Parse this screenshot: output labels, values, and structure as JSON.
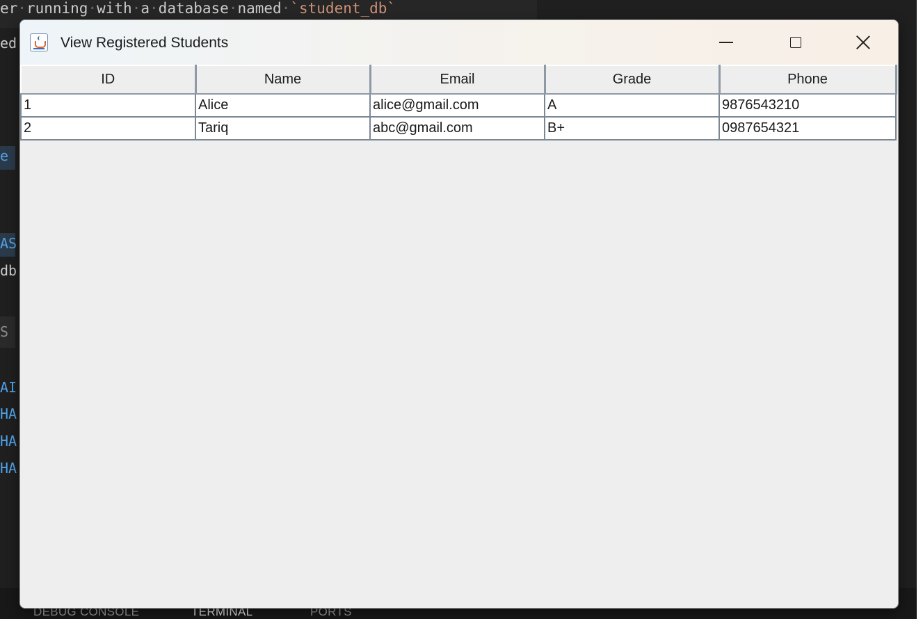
{
  "background_editor": {
    "top_line_prefix": "er",
    "top_line_words": [
      "running",
      "with",
      "a",
      "database",
      "named"
    ],
    "top_line_string": "`student_db`",
    "fragments": [
      "ed",
      "e",
      "AS",
      "db",
      "S",
      "AI",
      "HA",
      "HA",
      "HA"
    ],
    "panel_tabs": [
      "DEBUG CONSOLE",
      "TERMINAL",
      "PORTS"
    ],
    "active_panel_tab": "TERMINAL"
  },
  "window": {
    "title": "View Registered Students",
    "app_icon": "java-cup-icon",
    "controls": {
      "minimize_icon": "minimize-icon",
      "maximize_icon": "maximize-icon",
      "close_icon": "close-icon"
    }
  },
  "table": {
    "columns": [
      "ID",
      "Name",
      "Email",
      "Grade",
      "Phone"
    ],
    "rows": [
      [
        "1",
        "Alice",
        "alice@gmail.com",
        "A",
        "9876543210"
      ],
      [
        "2",
        "Tariq",
        "abc@gmail.com",
        "B+",
        "0987654321"
      ]
    ]
  }
}
